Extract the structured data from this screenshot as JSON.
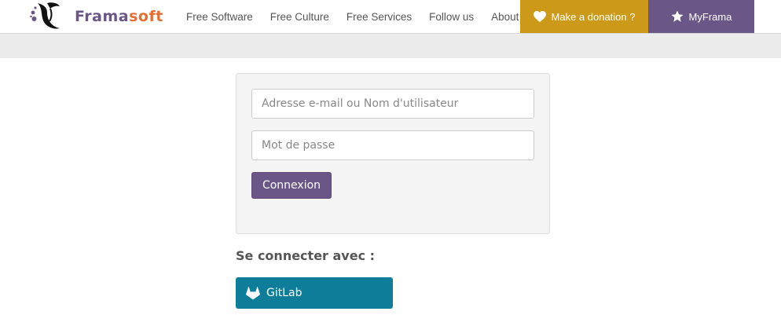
{
  "brand": {
    "name_part1": "Frama",
    "name_part2": "soft",
    "logo_icon": "framasoft-logo-icon"
  },
  "nav": {
    "items": [
      {
        "label": "Free Software"
      },
      {
        "label": "Free Culture"
      },
      {
        "label": "Free Services"
      },
      {
        "label": "Follow us"
      },
      {
        "label": "About"
      }
    ],
    "donate_label": "Make a donation ?",
    "donate_icon": "heart-icon",
    "myframa_label": "MyFrama",
    "myframa_icon": "star-icon"
  },
  "login": {
    "username_placeholder": "Adresse e-mail ou Nom d'utilisateur",
    "username_value": "",
    "password_placeholder": "Mot de passe",
    "password_value": "",
    "submit_label": "Connexion"
  },
  "social": {
    "title": "Se connecter avec :",
    "providers": [
      {
        "label": "GitLab",
        "icon": "gitlab-icon"
      }
    ]
  },
  "colors": {
    "brand_purple": "#6a5687",
    "brand_orange": "#e36f32",
    "donate_gold": "#cc9a18",
    "gitlab_teal": "#0e7d9a",
    "band_grey": "#ececec",
    "panel_bg": "#f4f4f4"
  }
}
